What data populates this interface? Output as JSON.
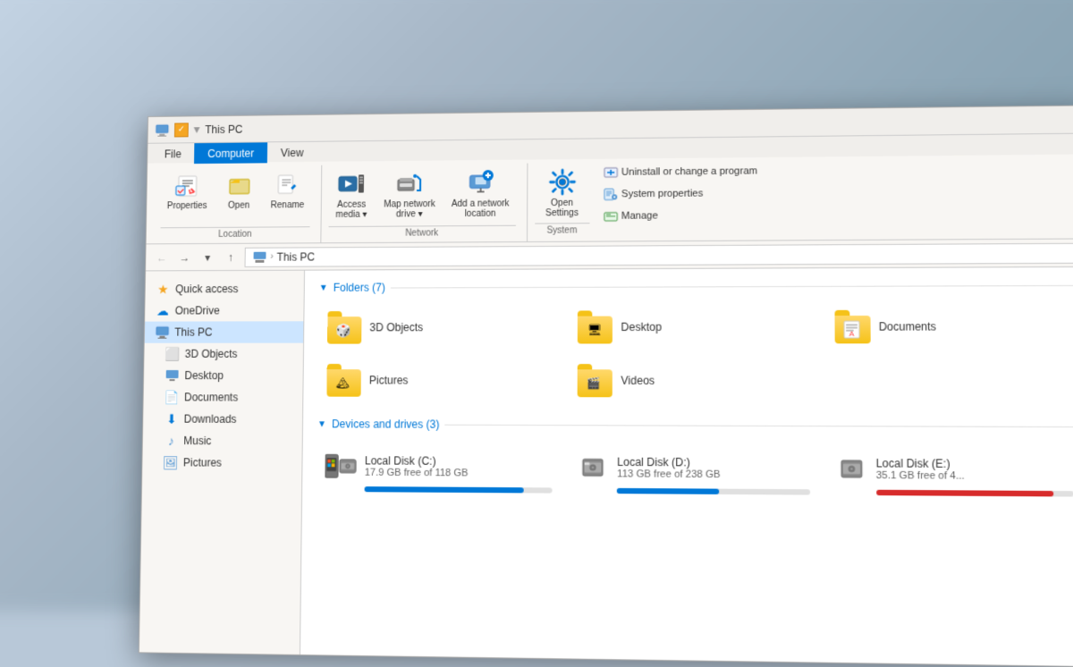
{
  "window": {
    "title": "This PC",
    "tabs": [
      {
        "label": "File",
        "active": false
      },
      {
        "label": "Computer",
        "active": true
      },
      {
        "label": "View",
        "active": false
      }
    ],
    "ribbon": {
      "groups": [
        {
          "name": "Location",
          "buttons": [
            {
              "label": "Properties",
              "icon": "props"
            },
            {
              "label": "Open",
              "icon": "open"
            },
            {
              "label": "Rename",
              "icon": "rename"
            }
          ]
        },
        {
          "name": "Network",
          "buttons": [
            {
              "label": "Access\nmedia",
              "icon": "access-media"
            },
            {
              "label": "Map network\ndrive",
              "icon": "map-drive"
            },
            {
              "label": "Add a network\nlocation",
              "icon": "add-network"
            }
          ]
        },
        {
          "name": "System",
          "large_button": {
            "label": "Open\nSettings",
            "icon": "gear"
          },
          "small_buttons": [
            {
              "label": "Uninstall or change a program",
              "icon": "uninstall"
            },
            {
              "label": "System properties",
              "icon": "sys-props"
            },
            {
              "label": "Manage",
              "icon": "manage"
            }
          ]
        }
      ]
    },
    "address": {
      "path": [
        "This PC"
      ],
      "breadcrumb": "This PC"
    },
    "sidebar": {
      "items": [
        {
          "label": "Quick access",
          "icon": "star",
          "active": false
        },
        {
          "label": "OneDrive",
          "icon": "cloud",
          "active": false
        },
        {
          "label": "This PC",
          "icon": "computer",
          "active": true
        },
        {
          "label": "3D Objects",
          "icon": "cube",
          "active": false
        },
        {
          "label": "Desktop",
          "icon": "desktop",
          "active": false
        },
        {
          "label": "Documents",
          "icon": "docs",
          "active": false
        },
        {
          "label": "Downloads",
          "icon": "downloads",
          "active": false
        },
        {
          "label": "Music",
          "icon": "music",
          "active": false
        },
        {
          "label": "Pictures",
          "icon": "pictures",
          "active": false
        }
      ]
    },
    "content": {
      "folders_section": {
        "title": "Folders (7)",
        "folders": [
          {
            "name": "3D Objects",
            "overlay": "🎲"
          },
          {
            "name": "Desktop",
            "overlay": "🖥"
          },
          {
            "name": "Documents",
            "overlay": "📄"
          },
          {
            "name": "Pictures",
            "overlay": "🖼"
          },
          {
            "name": "Videos",
            "overlay": "🎬"
          }
        ]
      },
      "drives_section": {
        "title": "Devices and drives (3)",
        "drives": [
          {
            "name": "Local Disk (C:)",
            "free": "17.9 GB free of 118 GB",
            "fill_pct": 85,
            "color": "blue"
          },
          {
            "name": "Local Disk (D:)",
            "free": "113 GB free of 238 GB",
            "fill_pct": 53,
            "color": "blue"
          },
          {
            "name": "Local Disk (E:)",
            "free": "35.1 GB free of 4...",
            "fill_pct": 90,
            "color": "red"
          }
        ]
      }
    }
  }
}
